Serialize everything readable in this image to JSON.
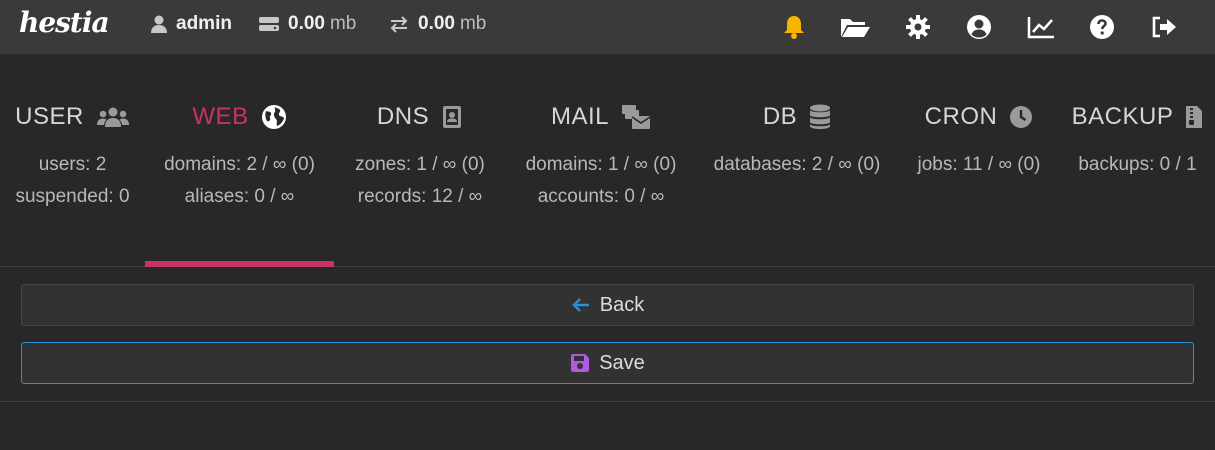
{
  "header": {
    "logo": "hestia",
    "user": "admin",
    "disk": {
      "value": "0.00",
      "unit": "mb"
    },
    "bandwidth": {
      "value": "0.00",
      "unit": "mb"
    },
    "icons": [
      "bell-icon",
      "folder-open-icon",
      "gear-icon",
      "user-circle-icon",
      "chart-line-icon",
      "help-icon",
      "logout-icon"
    ],
    "colors": {
      "bell": "#f7b500",
      "icons": "#ffffff"
    }
  },
  "tabs": [
    {
      "label": "USER",
      "icon": "users-icon",
      "line1": "users: 2",
      "line2": "suspended: 0",
      "active": false
    },
    {
      "label": "WEB",
      "icon": "globe-icon",
      "line1": "domains: 2 / ∞ (0)",
      "line2": "aliases: 0 / ∞",
      "active": true
    },
    {
      "label": "DNS",
      "icon": "address-book-icon",
      "line1": "zones: 1 / ∞ (0)",
      "line2": "records: 12 / ∞",
      "active": false
    },
    {
      "label": "MAIL",
      "icon": "mail-bulk-icon",
      "line1": "domains: 1 / ∞ (0)",
      "line2": "accounts: 0 / ∞",
      "active": false
    },
    {
      "label": "DB",
      "icon": "database-icon",
      "line1": "databases: 2 / ∞ (0)",
      "line2": "",
      "active": false
    },
    {
      "label": "CRON",
      "icon": "clock-icon",
      "line1": "jobs: 11 / ∞ (0)",
      "line2": "",
      "active": false
    },
    {
      "label": "BACKUP",
      "icon": "file-archive-icon",
      "line1": "backups: 0 / 1",
      "line2": "",
      "active": false
    }
  ],
  "accent": "#c8335f",
  "buttons": {
    "back_label": "Back",
    "save_label": "Save"
  }
}
